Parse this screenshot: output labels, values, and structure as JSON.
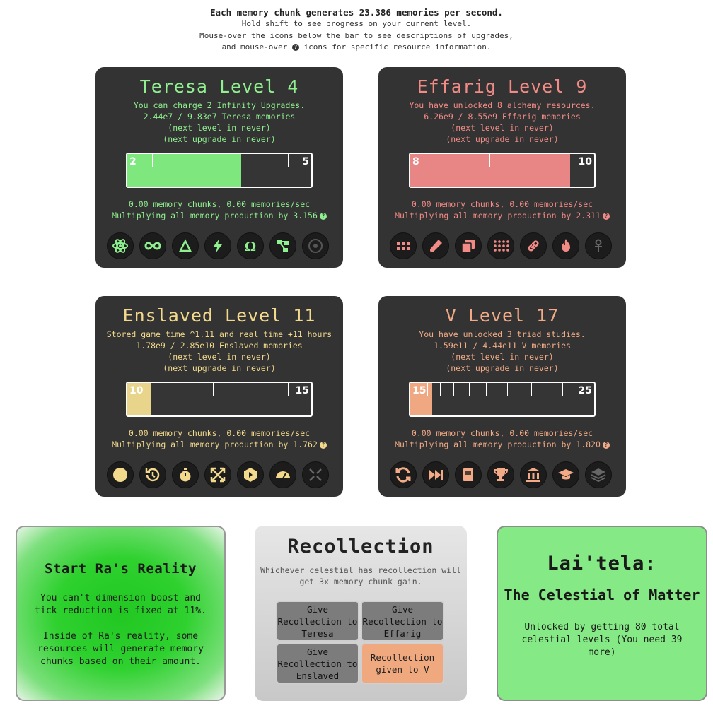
{
  "intro": {
    "line1": "Each memory chunk generates 23.386 memories per second.",
    "line2": "Hold shift to see progress on your current level.",
    "line3": "Mouse-over the icons below the bar to see descriptions of upgrades,",
    "line4_pre": "and mouse-over",
    "line4_post": "icons for specific resource information."
  },
  "celestials": [
    {
      "title": "Teresa Level 4",
      "desc1": "You can charge 2 Infinity Upgrades.",
      "desc2": "2.44e7 / 9.83e7 Teresa memories",
      "next_level": "(next level in never)",
      "next_upgrade": "(next upgrade in never)",
      "bar_left": "2",
      "bar_right": "5",
      "bar_progress": 0.62,
      "chunks": "0.00 memory chunks, 0.00 memories/sec",
      "multiplier": "Multiplying all memory production by 3.156",
      "color": "#8ff08f",
      "icons": [
        "atom-icon",
        "infinity-icon",
        "delta-icon",
        "lightning-icon",
        "omega-icon",
        "nodes-icon",
        "circle-dot-icon"
      ]
    },
    {
      "title": "Effarig Level 9",
      "desc1": "You have unlocked 8 alchemy resources.",
      "desc2": "6.26e9 / 8.55e9 Effarig memories",
      "next_level": "(next level in never)",
      "next_upgrade": "(next upgrade in never)",
      "bar_left": "8",
      "bar_right": "10",
      "bar_progress": 0.87,
      "chunks": "0.00 memory chunks, 0.00 memories/sec",
      "multiplier": "Multiplying all memory production by 2.311",
      "color": "#f28b86",
      "icons": [
        "grid-icon",
        "vial-icon",
        "clone-icon",
        "dots-grid-icon",
        "link-icon",
        "fire-icon",
        "ankh-icon"
      ]
    },
    {
      "title": "Enslaved Level 11",
      "desc1": "Stored game time ^1.11 and real time +11 hours",
      "desc2": "1.78e9 / 2.85e10 Enslaved memories",
      "next_level": "(next level in never)",
      "next_upgrade": "(next upgrade in never)",
      "bar_left": "10",
      "bar_right": "15",
      "bar_progress": 0.13,
      "chunks": "0.00 memory chunks, 0.00 memories/sec",
      "multiplier": "Multiplying all memory production by 1.762",
      "color": "#f2d98c",
      "icons": [
        "circle-icon",
        "history-icon",
        "stopwatch-icon",
        "expand-arrows-icon",
        "hexagon-icon",
        "gauge-icon",
        "compress-icon"
      ]
    },
    {
      "title": "V Level 17",
      "desc1": "You have unlocked 3 triad studies.",
      "desc2": "1.59e11 / 4.44e11 V memories",
      "next_level": "(next level in never)",
      "next_upgrade": "(next upgrade in never)",
      "bar_left": "15",
      "bar_right": "25",
      "bar_progress": 0.12,
      "chunks": "0.00 memory chunks, 0.00 memories/sec",
      "multiplier": "Multiplying all memory production by 1.820",
      "color": "#f2ab86",
      "icons": [
        "sync-icon",
        "fast-forward-icon",
        "book-icon",
        "trophy-icon",
        "landmark-icon",
        "graduation-cap-icon",
        "layers-icon"
      ]
    }
  ],
  "reality": {
    "title": "Start Ra's Reality",
    "para1": "You can't dimension boost and tick reduction is fixed at 11%.",
    "para2": "Inside of Ra's reality, some resources will generate memory chunks based on their amount."
  },
  "recollection": {
    "title": "Recollection",
    "desc": "Whichever celestial has recollection will get 3x memory chunk gain.",
    "buttons": [
      {
        "label": "Give Recollection to Teresa",
        "active": false
      },
      {
        "label": "Give Recollection to Effarig",
        "active": false
      },
      {
        "label": "Give Recollection to Enslaved",
        "active": false
      },
      {
        "label": "Recollection given to V",
        "active": true
      }
    ]
  },
  "laitela": {
    "title": "Lai'tela:",
    "subtitle": "The Celestial of Matter",
    "desc": "Unlocked by getting 80 total celestial levels (You need 39 more)"
  }
}
